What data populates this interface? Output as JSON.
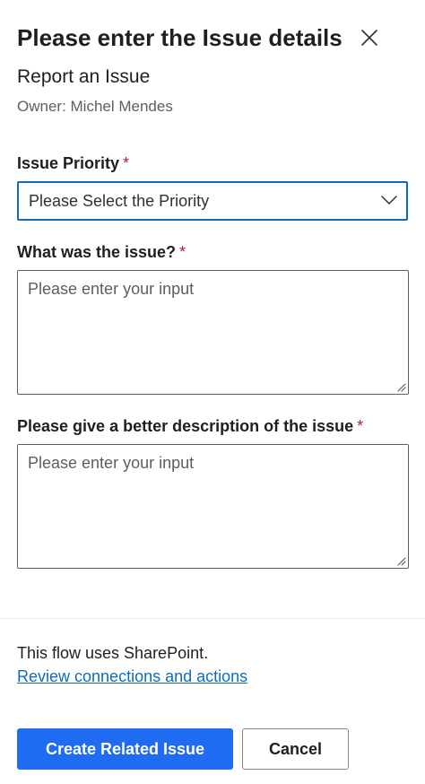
{
  "dialog": {
    "title": "Please enter the Issue details",
    "close_icon": "close-icon",
    "subtitle": "Report an Issue",
    "owner_label": "Owner: Michel Mendes"
  },
  "form": {
    "required_marker": "*",
    "priority": {
      "label": "Issue Priority",
      "selected": "Please Select the Priority",
      "icon": "chevron-down-icon"
    },
    "issue": {
      "label": "What was the issue?",
      "placeholder": "Please enter your input",
      "value": ""
    },
    "description": {
      "label": "Please give a better description of the issue",
      "placeholder": "Please enter your input",
      "value": ""
    }
  },
  "footer": {
    "note": "This flow uses SharePoint.",
    "link": "Review connections and actions",
    "primary_button": "Create Related Issue",
    "secondary_button": "Cancel"
  },
  "colors": {
    "accent": "#1f6cf2",
    "focus_border": "#0f6cbd",
    "required": "#a4262c",
    "link": "#0f6cbd"
  }
}
